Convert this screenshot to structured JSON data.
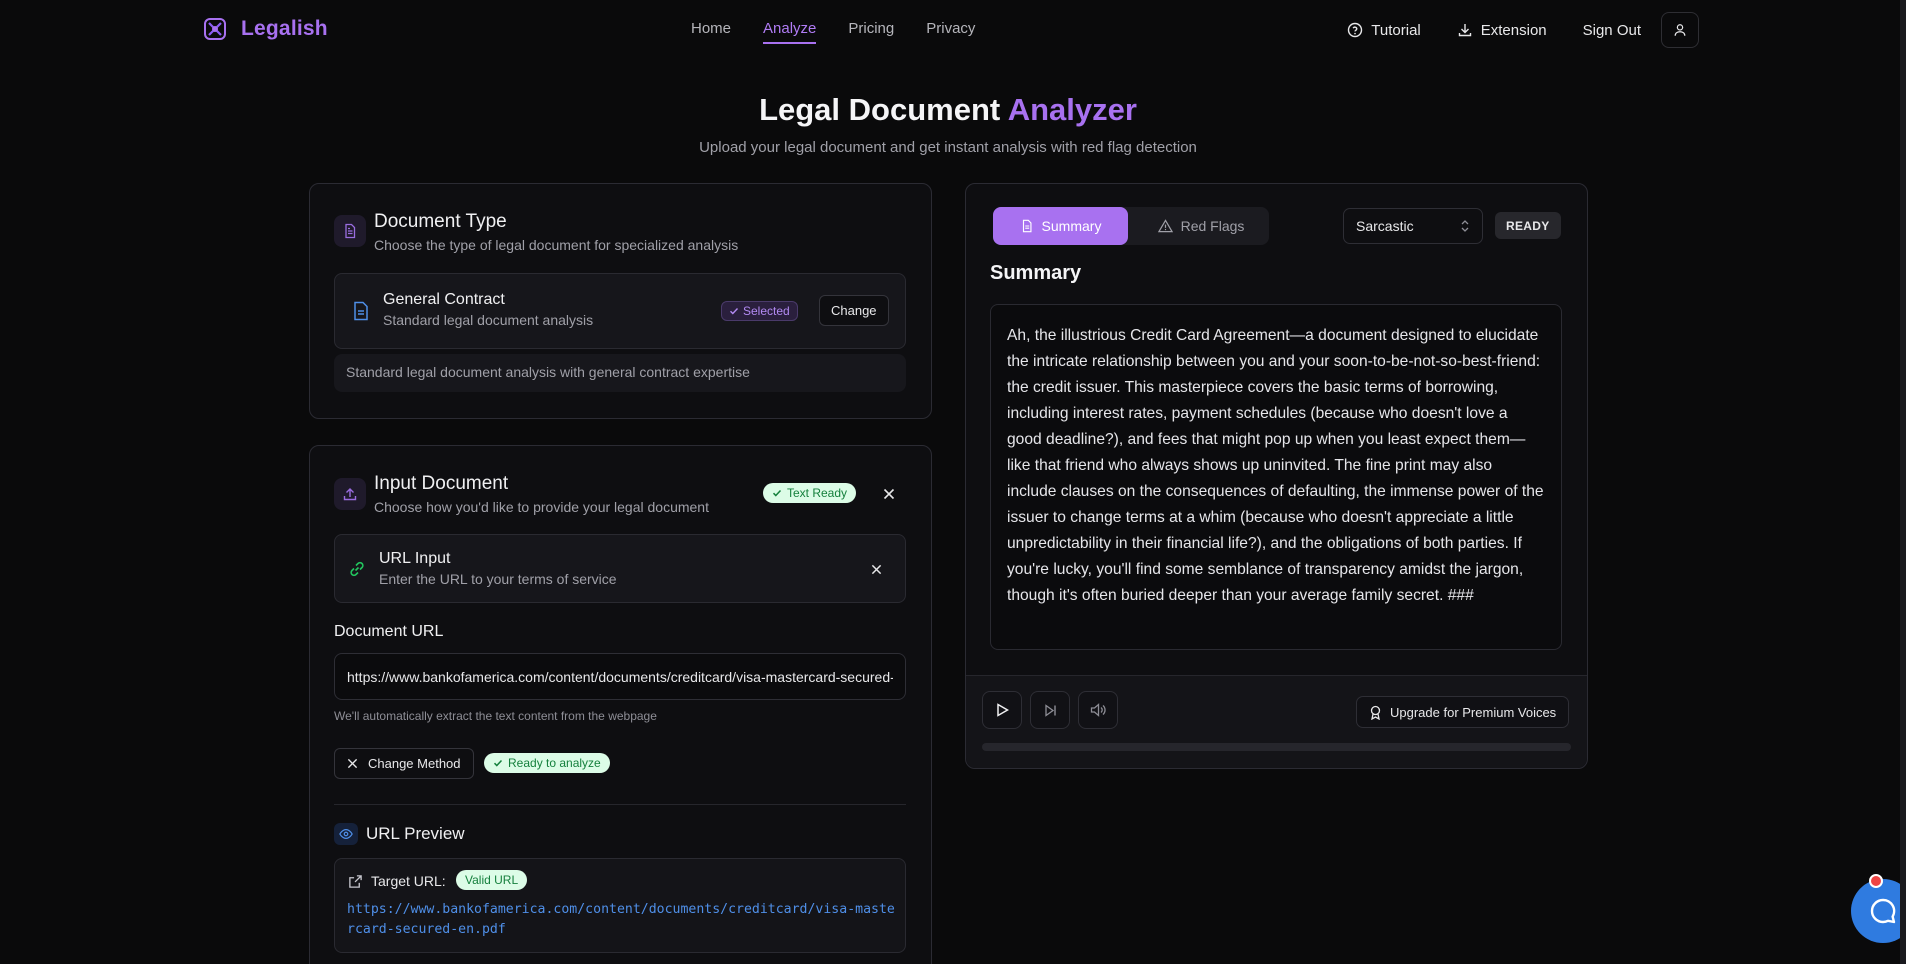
{
  "brand": {
    "name": "Legalish",
    "accent": "#a871f0"
  },
  "nav": {
    "links": [
      "Home",
      "Analyze",
      "Pricing",
      "Privacy"
    ],
    "active": "Analyze",
    "tutorial": "Tutorial",
    "extension": "Extension",
    "sign_out": "Sign Out"
  },
  "header": {
    "title_main": "Legal Document",
    "title_accent": "Analyzer",
    "subtitle": "Upload your legal document and get instant analysis with red flag detection"
  },
  "doc_type": {
    "title": "Document Type",
    "subtitle": "Choose the type of legal document for specialized analysis",
    "selected_name": "General Contract",
    "selected_desc": "Standard legal document analysis",
    "selected_badge": "Selected",
    "change_label": "Change",
    "note": "Standard legal document analysis with general contract expertise"
  },
  "input_doc": {
    "title": "Input Document",
    "subtitle": "Choose how you'd like to provide your legal document",
    "status_badge": "Text Ready",
    "method_title": "URL Input",
    "method_desc": "Enter the URL to your terms of service",
    "url_label": "Document URL",
    "url_value": "https://www.bankofamerica.com/content/documents/creditcard/visa-mastercard-secured-en.pdf",
    "url_help": "We'll automatically extract the text content from the webpage",
    "change_method": "Change Method",
    "ready_badge": "Ready to analyze",
    "preview_title": "URL Preview",
    "target_label": "Target URL:",
    "valid_badge": "Valid URL",
    "preview_url": "https://www.bankofamerica.com/content/documents/creditcard/visa-mastercard-secured-en.pdf"
  },
  "analysis": {
    "tab_summary": "Summary",
    "tab_redflags": "Red Flags",
    "tone": "Sarcastic",
    "status": "READY",
    "heading": "Summary",
    "summary_text": "Ah, the illustrious Credit Card Agreement—a document designed to elucidate the intricate relationship between you and your soon-to-be-not-so-best-friend: the credit issuer. This masterpiece covers the basic terms of borrowing, including interest rates, payment schedules (because who doesn't love a good deadline?), and fees that might pop up when you least expect them—like that friend who always shows up uninvited. The fine print may also include clauses on the consequences of defaulting, the immense power of the issuer to change terms at a whim (because who doesn't appreciate a little unpredictability in their financial life?), and the obligations of both parties. If you're lucky, you'll find some semblance of transparency amidst the jargon, though it's often buried deeper than your average family secret. ###",
    "upgrade_label": "Upgrade for Premium Voices",
    "progress": 0
  }
}
